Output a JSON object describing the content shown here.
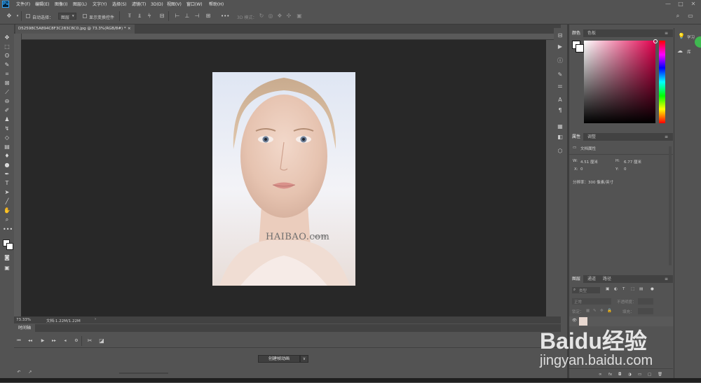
{
  "menubar": {
    "app_icon": "Ps",
    "items": [
      "文件(F)",
      "编辑(E)",
      "图像(I)",
      "图层(L)",
      "文字(Y)",
      "选择(S)",
      "滤镜(T)",
      "3D(D)",
      "视图(V)",
      "窗口(W)",
      "帮助(H)"
    ],
    "window_controls": [
      "—",
      "□",
      "✕"
    ]
  },
  "options": {
    "auto_select_label": "自动选择：",
    "auto_select_value": "图层",
    "transform_label": "显示变换控件",
    "more": "•••",
    "mode_3d_label": "3D 模式："
  },
  "document": {
    "tab_title": "D52598C5A894C8F3C283C8C0.jpg @ 73.3%(RGB/8#) *",
    "close": "×",
    "watermark_text": "HAIBAO.com",
    "watermark_sub": "海报时尚网"
  },
  "status": {
    "zoom": "73.33%",
    "doc_size": "文档:1.22M/1.22M",
    "arrow": "›"
  },
  "timeline": {
    "tab_label": "时间轴",
    "create_button": "创建帧动画",
    "dropdown": "∨"
  },
  "color_panel": {
    "tabs": [
      "颜色",
      "色板"
    ]
  },
  "properties_panel": {
    "tabs": [
      "属性",
      "调整"
    ],
    "section_title": "文档属性",
    "w_label": "W:",
    "w_value": "4.51 厘米",
    "h_label": "H:",
    "h_value": "6.77 厘米",
    "x_label": "X:",
    "x_value": "0",
    "y_label": "Y:",
    "y_value": "0",
    "resolution": "分辨率：300 像素/英寸"
  },
  "layers_panel": {
    "tabs": [
      "图层",
      "通道",
      "路径"
    ],
    "filter_placeholder": "类型",
    "blend_mode": "正常",
    "opacity_label": "不透明度：",
    "lock_label": "锁定：",
    "fill_label": "填充：",
    "footer_icons": [
      "∞",
      "fx",
      "◘",
      "◑",
      "▭",
      "▢",
      "🗑"
    ]
  },
  "learn": {
    "learn_label": "学习",
    "library_label": "库"
  },
  "watermark": {
    "brand": "Baidu经验",
    "url": "jingyan.baidu.com"
  },
  "colors": {
    "chrome": "#535353",
    "chrome_dark": "#424242",
    "workspace": "#282828",
    "accent": "#31a8ff"
  }
}
